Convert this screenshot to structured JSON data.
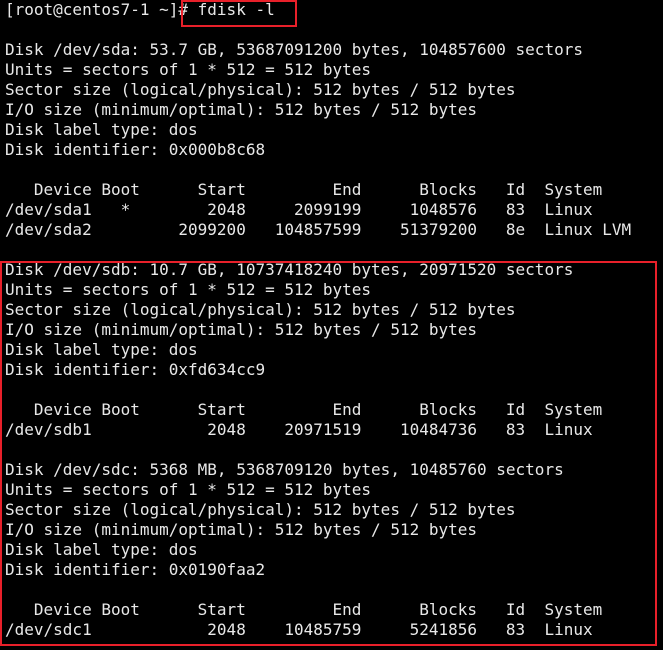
{
  "terminal": {
    "prompt": "[root@centos7-1 ~]",
    "command": "# fdisk -l",
    "lines": [
      "Disk /dev/sda: 53.7 GB, 53687091200 bytes, 104857600 sectors",
      "Units = sectors of 1 * 512 = 512 bytes",
      "Sector size (logical/physical): 512 bytes / 512 bytes",
      "I/O size (minimum/optimal): 512 bytes / 512 bytes",
      "Disk label type: dos",
      "Disk identifier: 0x000b8c68",
      "",
      "   Device Boot      Start         End      Blocks   Id  System",
      "/dev/sda1   *        2048     2099199     1048576   83  Linux",
      "/dev/sda2         2099200   104857599    51379200   8e  Linux LVM",
      "Disk /dev/sdb: 10.7 GB, 10737418240 bytes, 20971520 sectors",
      "Units = sectors of 1 * 512 = 512 bytes",
      "Sector size (logical/physical): 512 bytes / 512 bytes",
      "I/O size (minimum/optimal): 512 bytes / 512 bytes",
      "Disk label type: dos",
      "Disk identifier: 0xfd634cc9",
      "",
      "   Device Boot      Start         End      Blocks   Id  System",
      "/dev/sdb1            2048    20971519    10484736   83  Linux",
      "",
      "Disk /dev/sdc: 5368 MB, 5368709120 bytes, 10485760 sectors",
      "Units = sectors of 1 * 512 = 512 bytes",
      "Sector size (logical/physical): 512 bytes / 512 bytes",
      "I/O size (minimum/optimal): 512 bytes / 512 bytes",
      "Disk label type: dos",
      "Disk identifier: 0x0190faa2",
      "",
      "   Device Boot      Start         End      Blocks   Id  System",
      "/dev/sdc1            2048    10485759     5241856   83  Linux"
    ]
  },
  "colors": {
    "background": "#000000",
    "text": "#e8e8e8",
    "highlight": "#e8202a"
  }
}
